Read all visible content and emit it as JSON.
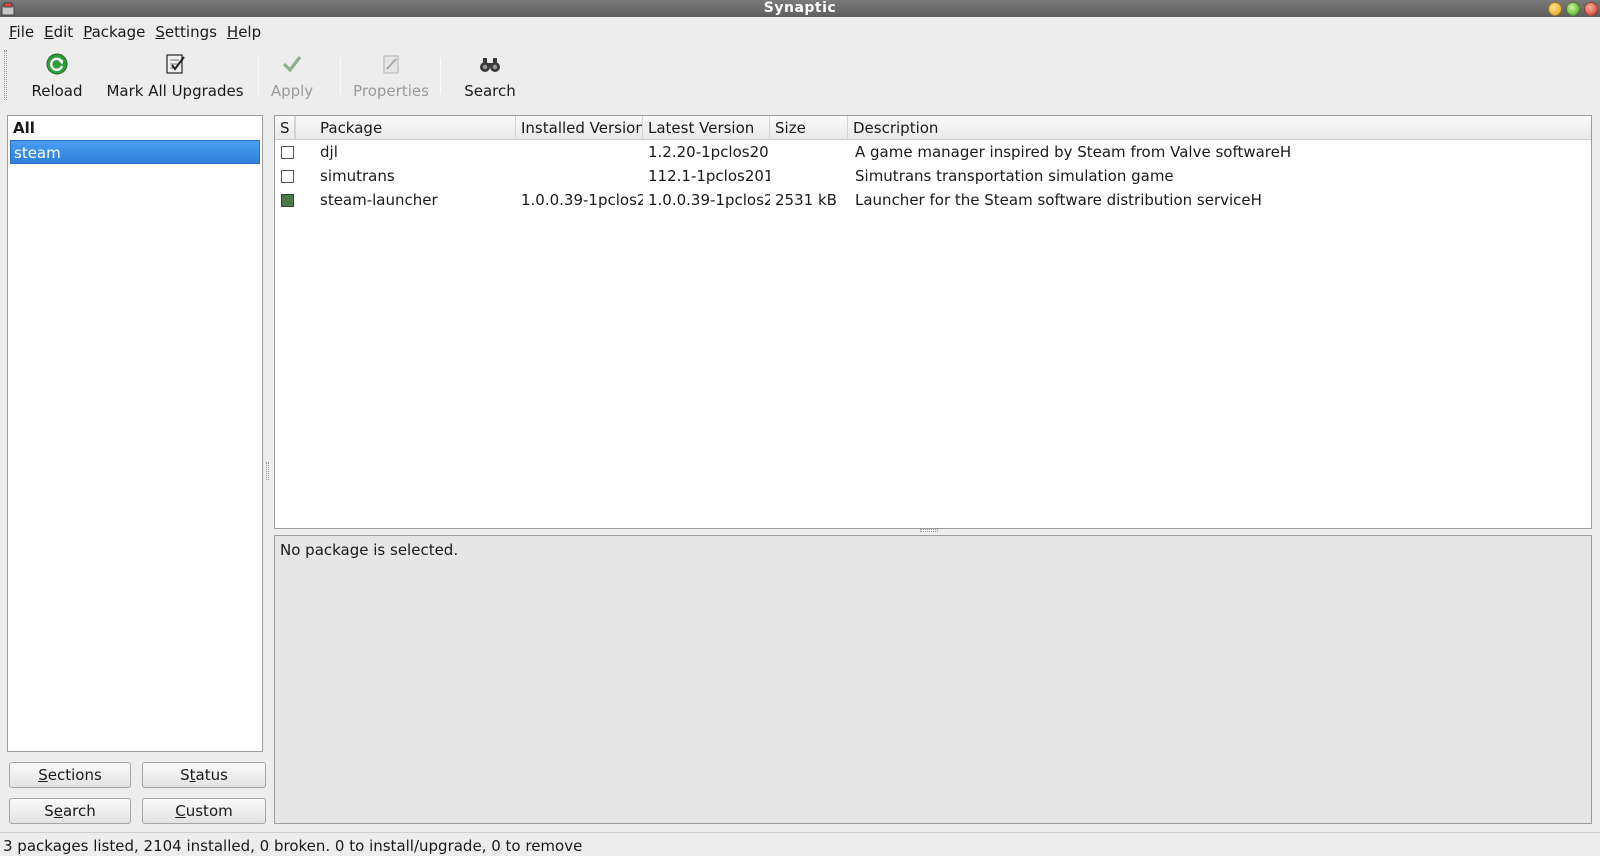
{
  "window": {
    "title": "Synaptic"
  },
  "menu": [
    {
      "key": "F",
      "rest": "ile"
    },
    {
      "key": "E",
      "rest": "dit"
    },
    {
      "key": "P",
      "rest": "ackage"
    },
    {
      "key": "S",
      "rest": "ettings"
    },
    {
      "key": "H",
      "rest": "elp"
    }
  ],
  "toolbar": {
    "reload": "Reload",
    "mark_all_upgrades": "Mark All Upgrades",
    "apply": "Apply",
    "properties": "Properties",
    "search": "Search"
  },
  "filters": {
    "items": [
      {
        "label": "All",
        "header": true
      },
      {
        "label": "steam",
        "selected": true
      }
    ]
  },
  "filter_buttons": {
    "sections": {
      "key": "S",
      "rest": "ections"
    },
    "status": {
      "pre": "S",
      "key": "t",
      "rest": "atus"
    },
    "search": {
      "pre": "S",
      "key": "e",
      "rest": "arch"
    },
    "custom": {
      "key": "C",
      "rest": "ustom"
    }
  },
  "table": {
    "columns": [
      "S",
      "Package",
      "Installed Version",
      "Latest Version",
      "Size",
      "Description"
    ],
    "rows": [
      {
        "installed": false,
        "package": "djl",
        "installed_version": "",
        "latest_version": "1.2.20-1pclos20:",
        "size": "",
        "description": "A game manager inspired by Steam from Valve softwareH"
      },
      {
        "installed": false,
        "package": "simutrans",
        "installed_version": "",
        "latest_version": "112.1-1pclos201",
        "size": "",
        "description": "Simutrans transportation simulation game"
      },
      {
        "installed": true,
        "package": "steam-launcher",
        "installed_version": "1.0.0.39-1pclos2",
        "latest_version": "1.0.0.39-1pclos2",
        "size": "2531 kB",
        "description": "Launcher for the Steam software distribution serviceH"
      }
    ]
  },
  "details": {
    "message": "No package is selected."
  },
  "status": {
    "text": "3 packages listed, 2104 installed, 0 broken. 0 to install/upgrade, 0 to remove"
  }
}
